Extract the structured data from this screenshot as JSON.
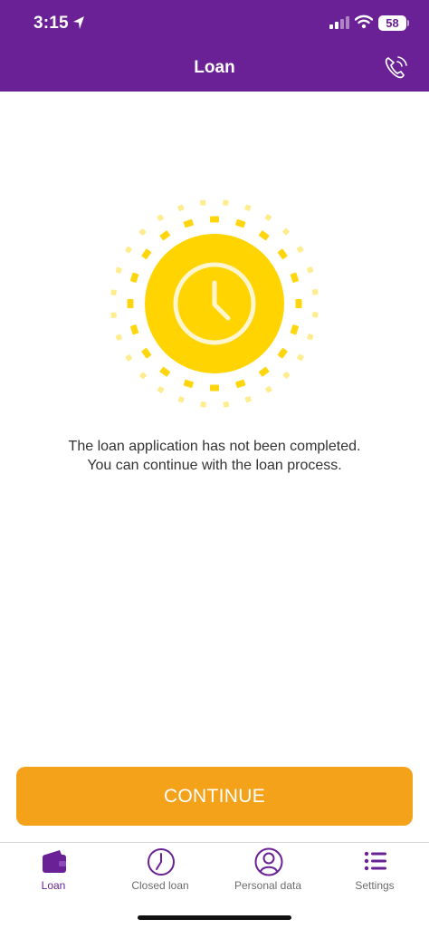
{
  "status_bar": {
    "time": "3:15",
    "battery": "58"
  },
  "header": {
    "title": "Loan",
    "call_icon": "phone-icon"
  },
  "illustration": {
    "icon": "clock-icon",
    "sun_color": "#ffd400"
  },
  "message": {
    "line1": "The loan application has not been completed.",
    "line2": "You can continue with the loan process."
  },
  "primary_action": {
    "label": "CONTINUE"
  },
  "tabbar": {
    "items": [
      {
        "label": "Loan",
        "icon": "wallet-icon",
        "active": true
      },
      {
        "label": "Closed loan",
        "icon": "clock-icon",
        "active": false
      },
      {
        "label": "Personal data",
        "icon": "user-icon",
        "active": false
      },
      {
        "label": "Settings",
        "icon": "list-icon",
        "active": false
      }
    ]
  },
  "colors": {
    "brand": "#6a2196",
    "accent": "#f4a21a",
    "sun": "#ffd400"
  }
}
